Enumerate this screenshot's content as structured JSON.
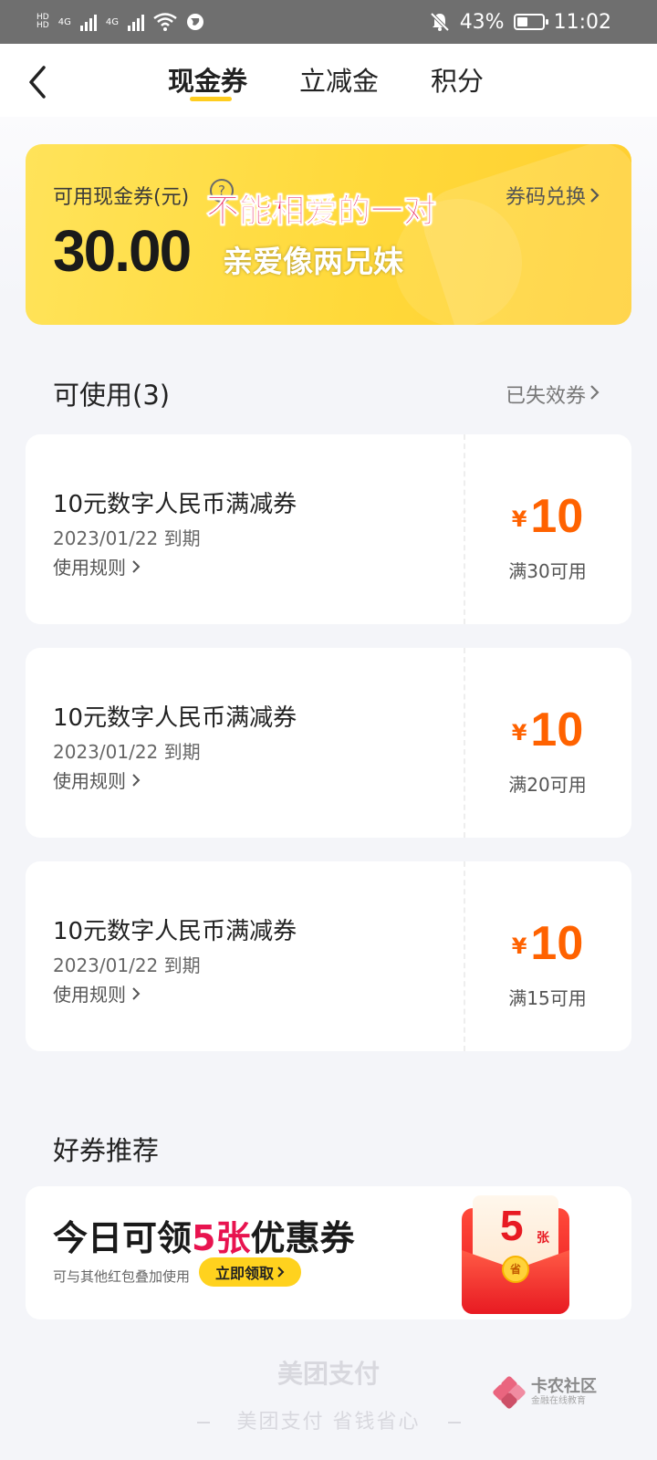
{
  "status_bar": {
    "net1": "4G",
    "net2": "4G",
    "battery": "43%",
    "battery_level": 0.43,
    "time": "11:02"
  },
  "nav": {
    "tabs": [
      "现金券",
      "立减金",
      "积分"
    ],
    "active_tab": 0
  },
  "hero": {
    "label": "可用现金券(元)",
    "help": "?",
    "amount": "30.00",
    "exchange_label": "券码兑换",
    "overlay_line1": "不能相爱的一对",
    "overlay_line2": "亲爱像两兄妹"
  },
  "available": {
    "title": "可使用(3)",
    "expired_link": "已失效券"
  },
  "coupons": [
    {
      "name": "10元数字人民币满减券",
      "date": "2023/01/22 到期",
      "rules": "使用规则",
      "yen": "¥",
      "amount": "10",
      "condition": "满30可用"
    },
    {
      "name": "10元数字人民币满减券",
      "date": "2023/01/22 到期",
      "rules": "使用规则",
      "yen": "¥",
      "amount": "10",
      "condition": "满20可用"
    },
    {
      "name": "10元数字人民币满减券",
      "date": "2023/01/22 到期",
      "rules": "使用规则",
      "yen": "¥",
      "amount": "10",
      "condition": "满15可用"
    }
  ],
  "recommend": {
    "title": "好券推荐",
    "headline_pre": "今日可领",
    "headline_highlight": "5张",
    "headline_post": "优惠券",
    "sub": "可与其他红包叠加使用",
    "button": "立即领取",
    "packet_number": "5",
    "packet_unit": "张",
    "packet_coin": "省"
  },
  "footer": {
    "brand": "美团支付",
    "slogan": "美团支付 省钱省心"
  },
  "watermark": {
    "title": "卡农社区",
    "subtitle": "金融在线教育"
  },
  "colors": {
    "accent_yellow": "#ffd21e",
    "price_orange": "#ff6200",
    "highlight_red": "#e8134f"
  }
}
